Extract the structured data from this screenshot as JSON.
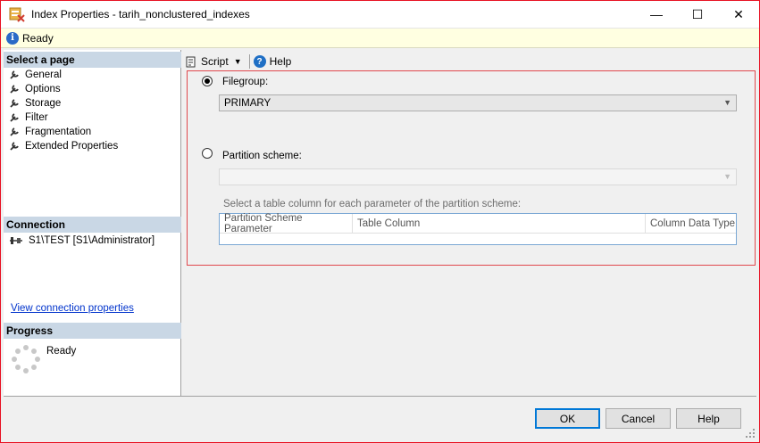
{
  "window": {
    "title": "Index Properties - tarih_nonclustered_indexes",
    "controls": {
      "minimize": "—",
      "maximize": "☐",
      "close": "✕"
    }
  },
  "status": {
    "text": "Ready"
  },
  "left_panel": {
    "select_page_header": "Select a page",
    "pages": [
      {
        "label": "General"
      },
      {
        "label": "Options"
      },
      {
        "label": "Storage"
      },
      {
        "label": "Filter"
      },
      {
        "label": "Fragmentation"
      },
      {
        "label": "Extended Properties"
      }
    ],
    "connection_header": "Connection",
    "connection_text": "S1\\TEST [S1\\Administrator]",
    "view_connection_link": "View connection properties",
    "progress_header": "Progress",
    "progress_text": "Ready"
  },
  "toolbar": {
    "script_label": "Script",
    "help_label": "Help"
  },
  "storage": {
    "filegroup_label": "Filegroup:",
    "filegroup_selected": true,
    "filegroup_value": "PRIMARY",
    "partition_label": "Partition scheme:",
    "partition_selected": false,
    "partition_value": "",
    "grid_caption": "Select a table column for each parameter of the partition scheme:",
    "grid_columns": [
      "Partition Scheme Parameter",
      "Table Column",
      "Column Data Type"
    ]
  },
  "buttons": {
    "ok": "OK",
    "cancel": "Cancel",
    "help": "Help"
  },
  "colors": {
    "accent": "#0078d7",
    "highlight_border": "#e0484d",
    "window_border": "#e81123"
  }
}
